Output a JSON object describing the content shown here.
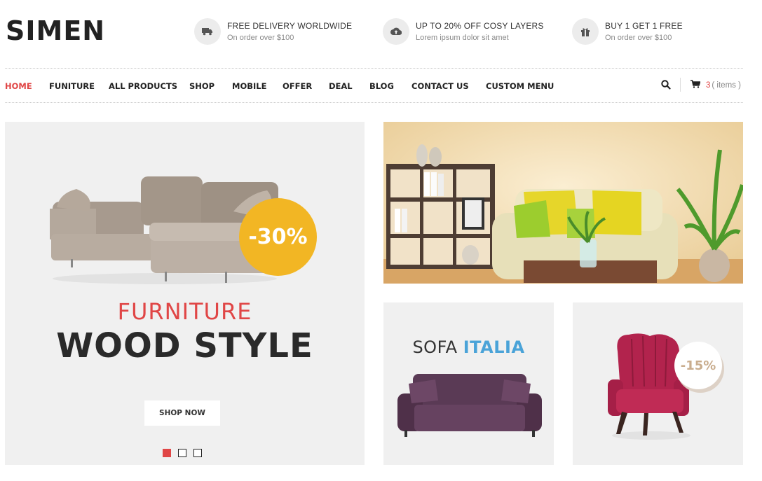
{
  "brand": {
    "logo": "SIMEN"
  },
  "promos": [
    {
      "icon": "truck-icon",
      "title": "FREE DELIVERY WORLDWIDE",
      "subtitle": "On order over $100"
    },
    {
      "icon": "cloud-upload-icon",
      "title": "UP TO 20% OFF COSY LAYERS",
      "subtitle": "Lorem ipsum dolor sit amet"
    },
    {
      "icon": "gift-icon",
      "title": "BUY 1 GET 1 FREE",
      "subtitle": "On order over $100"
    }
  ],
  "nav": {
    "items": [
      "HOME",
      "FUNITURE",
      "ALL PRODUCTS",
      "SHOP",
      "MOBILE",
      "OFFER",
      "DEAL",
      "BLOG",
      "CONTACT US",
      "CUSTOM MENU"
    ],
    "active": "HOME",
    "cart_count": "3",
    "cart_label": "( items )"
  },
  "hero": {
    "badge": "-30%",
    "subtitle": "FURNITURE",
    "title": "WOOD STYLE",
    "button": "SHOP NOW",
    "slides": 3,
    "active_slide": 1
  },
  "banners": {
    "sofa": {
      "title_plain": "SOFA",
      "title_accent": "ITALIA"
    },
    "chair": {
      "badge": "-15%"
    }
  },
  "colors": {
    "accent_red": "#e04646",
    "badge_yellow": "#f2b624",
    "italia_blue": "#4aa3d8",
    "panel_gray": "#f0f0f0"
  }
}
